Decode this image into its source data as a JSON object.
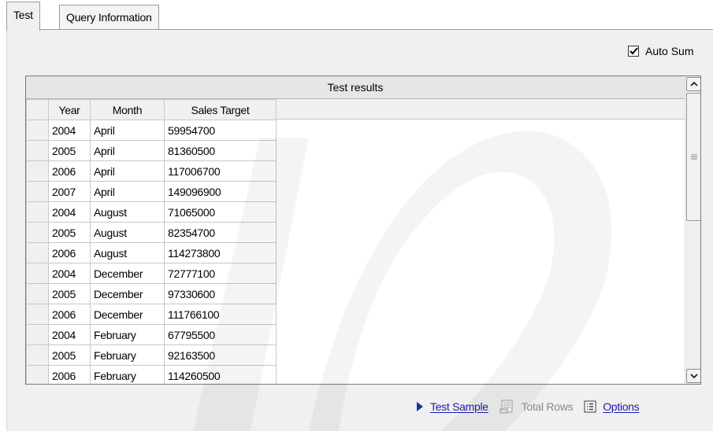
{
  "tabs": [
    {
      "label": "Test",
      "active": true
    },
    {
      "label": "Query Information",
      "active": false
    }
  ],
  "auto_sum": {
    "label": "Auto Sum",
    "checked": true
  },
  "grid": {
    "caption": "Test results",
    "columns": [
      "Year",
      "Month",
      "Sales Target"
    ],
    "rows": [
      [
        "2004",
        "April",
        "59954700"
      ],
      [
        "2005",
        "April",
        "81360500"
      ],
      [
        "2006",
        "April",
        "117006700"
      ],
      [
        "2007",
        "April",
        "149096900"
      ],
      [
        "2004",
        "August",
        "71065000"
      ],
      [
        "2005",
        "August",
        "82354700"
      ],
      [
        "2006",
        "August",
        "114273800"
      ],
      [
        "2004",
        "December",
        "72777100"
      ],
      [
        "2005",
        "December",
        "97330600"
      ],
      [
        "2006",
        "December",
        "111766100"
      ],
      [
        "2004",
        "February",
        "67795500"
      ],
      [
        "2005",
        "February",
        "92163500"
      ],
      [
        "2006",
        "February",
        "114260500"
      ]
    ]
  },
  "actions": {
    "test_sample": "Test Sample",
    "total_rows": "Total Rows",
    "options": "Options"
  },
  "colors": {
    "link": "#1a1ab0",
    "disabled": "#8a8a8a",
    "panel": "#f0f0f0",
    "play_icon": "#1d2f8f"
  },
  "icons": [
    "play-icon",
    "total-rows-icon",
    "options-list-icon",
    "checkmark-icon",
    "scroll-up-icon",
    "scroll-down-icon",
    "scroll-grip-icon"
  ]
}
